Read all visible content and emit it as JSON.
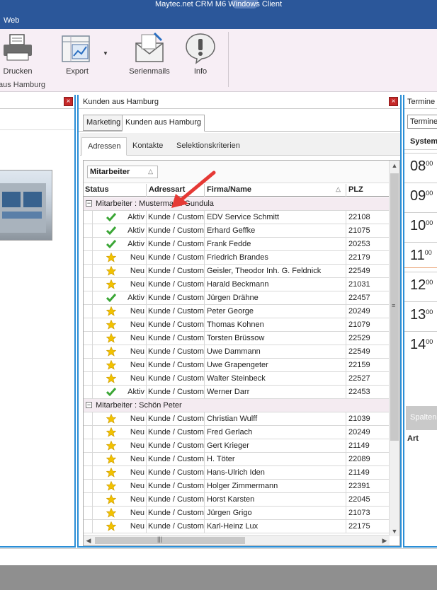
{
  "window": {
    "title": "Maytec.net CRM M6 Windows Client"
  },
  "menu": {
    "items": [
      "Web"
    ]
  },
  "ribbon": {
    "buttons": [
      {
        "label": "Drucken",
        "icon": "printer-icon"
      },
      {
        "label": "Export",
        "icon": "export-chart-icon"
      },
      {
        "label": "Serienmails",
        "icon": "mail-envelope-icon"
      },
      {
        "label": "Info",
        "icon": "info-bubble-icon"
      }
    ],
    "group_label": "aus Hamburg"
  },
  "center_panel": {
    "title": "Kunden aus Hamburg",
    "top_tabs": [
      "Marketing",
      "Kunden aus Hamburg"
    ],
    "sub_tabs": [
      "Adressen",
      "Kontakte",
      "Selektionskriterien"
    ],
    "group_chip": "Mitarbeiter",
    "columns": {
      "status": "Status",
      "adressart": "Adressart",
      "firma": "Firma/Name",
      "plz": "PLZ"
    },
    "groups": [
      {
        "label": "Mitarbeiter : Mustermann Gundula",
        "rows": [
          {
            "status": "Aktiv",
            "icon": "check",
            "adressart": "Kunde / Custom",
            "firma": "EDV Service Schmitt",
            "plz": "22108"
          },
          {
            "status": "Aktiv",
            "icon": "check",
            "adressart": "Kunde / Custom",
            "firma": "Erhard Geffke",
            "plz": "21075"
          },
          {
            "status": "Aktiv",
            "icon": "check",
            "adressart": "Kunde / Custom",
            "firma": "Frank Fedde",
            "plz": "20253"
          },
          {
            "status": "Neu",
            "icon": "star",
            "adressart": "Kunde / Custom",
            "firma": "Friedrich Brandes",
            "plz": "22179"
          },
          {
            "status": "Neu",
            "icon": "star",
            "adressart": "Kunde / Custom",
            "firma": "Geisler, Theodor Inh. G. Feldnick",
            "plz": "22549"
          },
          {
            "status": "Neu",
            "icon": "star",
            "adressart": "Kunde / Custom",
            "firma": "Harald Beckmann",
            "plz": "21031"
          },
          {
            "status": "Aktiv",
            "icon": "check",
            "adressart": "Kunde / Custom",
            "firma": "Jürgen Drähne",
            "plz": "22457"
          },
          {
            "status": "Neu",
            "icon": "star",
            "adressart": "Kunde / Custom",
            "firma": "Peter George",
            "plz": "20249"
          },
          {
            "status": "Neu",
            "icon": "star",
            "adressart": "Kunde / Custom",
            "firma": "Thomas Kohnen",
            "plz": "21079"
          },
          {
            "status": "Neu",
            "icon": "star",
            "adressart": "Kunde / Custom",
            "firma": "Torsten Brüssow",
            "plz": "22529"
          },
          {
            "status": "Neu",
            "icon": "star",
            "adressart": "Kunde / Custom",
            "firma": "Uwe Dammann",
            "plz": "22549"
          },
          {
            "status": "Neu",
            "icon": "star",
            "adressart": "Kunde / Custom",
            "firma": "Uwe Grapengeter",
            "plz": "22159"
          },
          {
            "status": "Neu",
            "icon": "star",
            "adressart": "Kunde / Custom",
            "firma": "Walter Steinbeck",
            "plz": "22527"
          },
          {
            "status": "Aktiv",
            "icon": "check",
            "adressart": "Kunde / Custom",
            "firma": "Werner Darr",
            "plz": "22453"
          }
        ]
      },
      {
        "label": "Mitarbeiter : Schön Peter",
        "rows": [
          {
            "status": "Neu",
            "icon": "star",
            "adressart": "Kunde / Custom",
            "firma": "Christian Wulff",
            "plz": "21039"
          },
          {
            "status": "Neu",
            "icon": "star",
            "adressart": "Kunde / Custom",
            "firma": "Fred Gerlach",
            "plz": "20249"
          },
          {
            "status": "Neu",
            "icon": "star",
            "adressart": "Kunde / Custom",
            "firma": "Gert Krieger",
            "plz": "21149"
          },
          {
            "status": "Neu",
            "icon": "star",
            "adressart": "Kunde / Custom",
            "firma": "H. Töter",
            "plz": "22089"
          },
          {
            "status": "Neu",
            "icon": "star",
            "adressart": "Kunde / Custom",
            "firma": "Hans-Ulrich Iden",
            "plz": "21149"
          },
          {
            "status": "Neu",
            "icon": "star",
            "adressart": "Kunde / Custom",
            "firma": "Holger Zimmermann",
            "plz": "22391"
          },
          {
            "status": "Neu",
            "icon": "star",
            "adressart": "Kunde / Custom",
            "firma": "Horst Karsten",
            "plz": "22045"
          },
          {
            "status": "Neu",
            "icon": "star",
            "adressart": "Kunde / Custom",
            "firma": "Jürgen Grigo",
            "plz": "21073"
          },
          {
            "status": "Neu",
            "icon": "star",
            "adressart": "Kunde / Custom",
            "firma": "Karl-Heinz Lux",
            "plz": "22175"
          }
        ]
      }
    ]
  },
  "right_panel": {
    "title": "Termine",
    "dropdown": "Termine",
    "header": "System",
    "hours": [
      "08",
      "09",
      "10",
      "11",
      "12",
      "13",
      "14"
    ],
    "minutes": "00",
    "spalten": "Spalten",
    "art": "Art"
  },
  "colors": {
    "accent": "#2b579a",
    "panel_border": "#2b8ed6",
    "check": "#3aa635",
    "star": "#f2c200",
    "arrow": "#e53935"
  }
}
